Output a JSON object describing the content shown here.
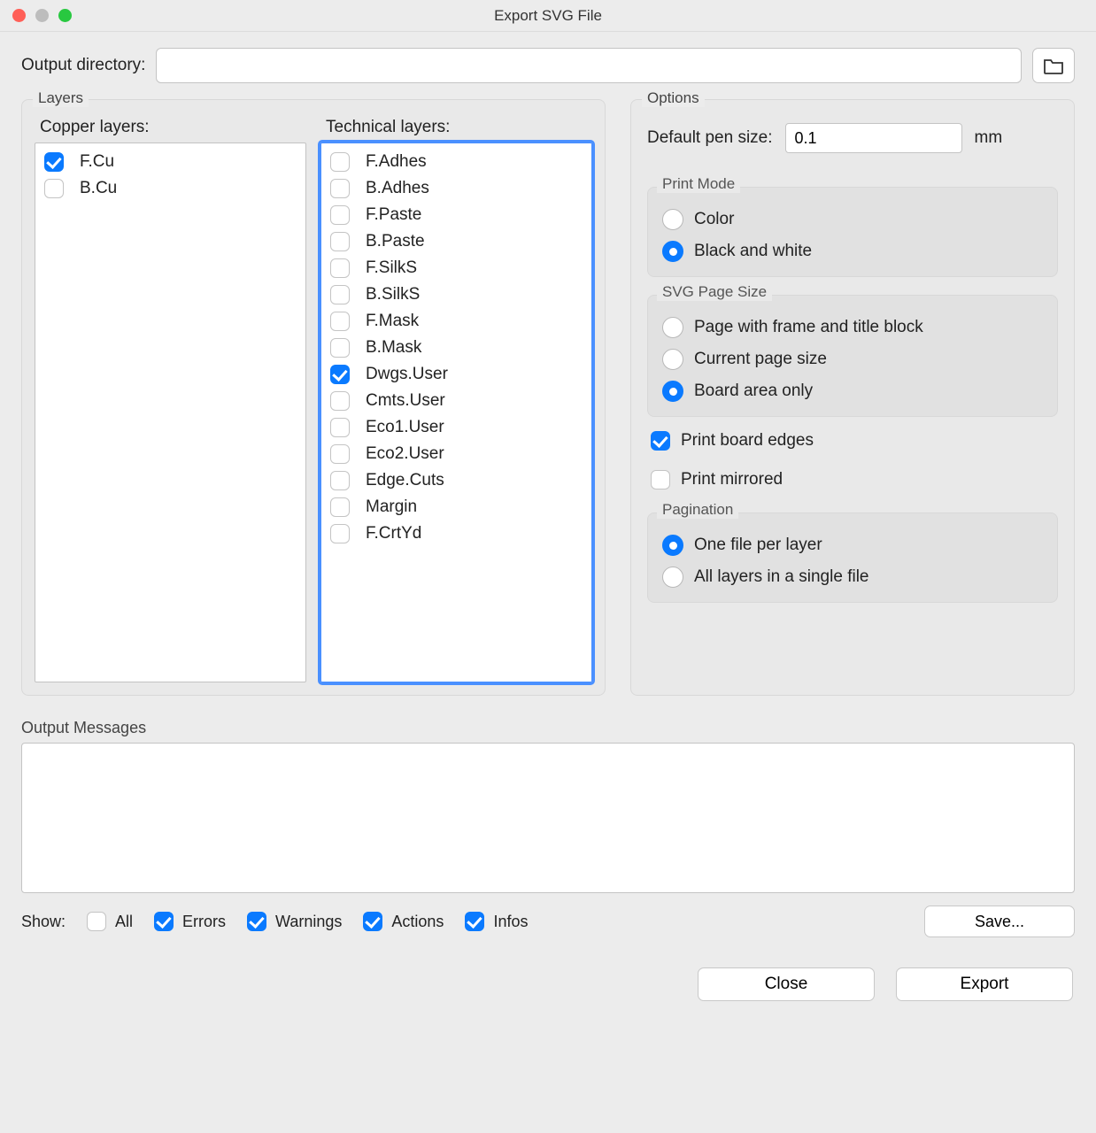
{
  "window": {
    "title": "Export SVG File"
  },
  "output_dir": {
    "label": "Output directory:",
    "value": ""
  },
  "layers": {
    "legend": "Layers",
    "copper": {
      "title": "Copper layers:",
      "items": [
        {
          "label": "F.Cu",
          "checked": true
        },
        {
          "label": "B.Cu",
          "checked": false
        }
      ]
    },
    "technical": {
      "title": "Technical layers:",
      "items": [
        {
          "label": "F.Adhes",
          "checked": false
        },
        {
          "label": "B.Adhes",
          "checked": false
        },
        {
          "label": "F.Paste",
          "checked": false
        },
        {
          "label": "B.Paste",
          "checked": false
        },
        {
          "label": "F.SilkS",
          "checked": false
        },
        {
          "label": "B.SilkS",
          "checked": false
        },
        {
          "label": "F.Mask",
          "checked": false
        },
        {
          "label": "B.Mask",
          "checked": false
        },
        {
          "label": "Dwgs.User",
          "checked": true
        },
        {
          "label": "Cmts.User",
          "checked": false
        },
        {
          "label": "Eco1.User",
          "checked": false
        },
        {
          "label": "Eco2.User",
          "checked": false
        },
        {
          "label": "Edge.Cuts",
          "checked": false
        },
        {
          "label": "Margin",
          "checked": false
        },
        {
          "label": "F.CrtYd",
          "checked": false
        }
      ]
    }
  },
  "options": {
    "legend": "Options",
    "pen_size": {
      "label": "Default pen size:",
      "value": "0.1",
      "unit": "mm"
    },
    "print_mode": {
      "legend": "Print Mode",
      "options": [
        "Color",
        "Black and white"
      ],
      "selected": 1
    },
    "page_size": {
      "legend": "SVG Page Size",
      "options": [
        "Page with frame and title block",
        "Current page size",
        "Board area only"
      ],
      "selected": 2
    },
    "print_edges": {
      "label": "Print board edges",
      "checked": true
    },
    "print_mirrored": {
      "label": "Print mirrored",
      "checked": false
    },
    "pagination": {
      "legend": "Pagination",
      "options": [
        "One file per layer",
        "All layers in a single file"
      ],
      "selected": 0
    }
  },
  "messages": {
    "label": "Output Messages",
    "show_label": "Show:",
    "filters": {
      "all": {
        "label": "All",
        "checked": false
      },
      "errors": {
        "label": "Errors",
        "checked": true
      },
      "warnings": {
        "label": "Warnings",
        "checked": true
      },
      "actions": {
        "label": "Actions",
        "checked": true
      },
      "infos": {
        "label": "Infos",
        "checked": true
      }
    },
    "save_label": "Save..."
  },
  "buttons": {
    "close": "Close",
    "export": "Export"
  }
}
